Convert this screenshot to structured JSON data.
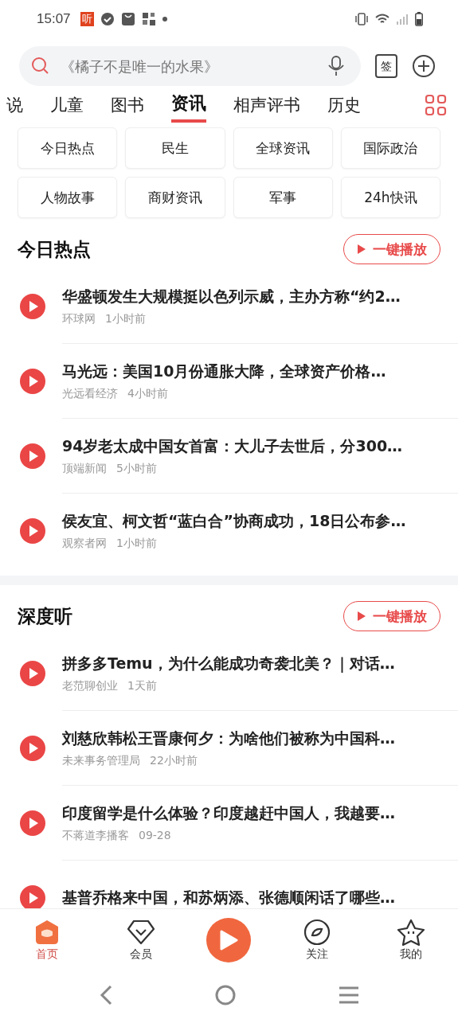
{
  "status_bar": {
    "time": "15:07",
    "app_badge": "听"
  },
  "search": {
    "placeholder": "《橘子不是唯一的水果》",
    "sign_label": "签"
  },
  "tabs": [
    {
      "label": "说",
      "selected": false
    },
    {
      "label": "儿童",
      "selected": false
    },
    {
      "label": "图书",
      "selected": false
    },
    {
      "label": "资讯",
      "selected": true
    },
    {
      "label": "相声评书",
      "selected": false
    },
    {
      "label": "历史",
      "selected": false
    }
  ],
  "categories": [
    "今日热点",
    "民生",
    "全球资讯",
    "国际政治",
    "人物故事",
    "商财资讯",
    "军事",
    "24h快讯"
  ],
  "sections": [
    {
      "title": "今日热点",
      "play_all": "一键播放",
      "items": [
        {
          "title": "华盛顿发生大规模挺以色列示威，主办方称“约2…",
          "source": "环球网",
          "time": "1小时前"
        },
        {
          "title": "马光远：美国10月份通胀大降，全球资产价格…",
          "source": "光远看经济",
          "time": "4小时前"
        },
        {
          "title": "94岁老太成中国女首富：大儿子去世后，分300…",
          "source": "顶端新闻",
          "time": "5小时前"
        },
        {
          "title": "侯友宜、柯文哲“蓝白合”协商成功，18日公布参…",
          "source": "观察者网",
          "time": "1小时前"
        }
      ]
    },
    {
      "title": "深度听",
      "play_all": "一键播放",
      "items": [
        {
          "title": "拼多多Temu，为什么能成功奇袭北美？｜对话…",
          "source": "老范聊创业",
          "time": "1天前"
        },
        {
          "title": "刘慈欣韩松王晋康何夕：为啥他们被称为中国科…",
          "source": "未来事务管理局",
          "time": "22小时前"
        },
        {
          "title": "印度留学是什么体验？印度越赶中国人，我越要…",
          "source": "不蒋道李播客",
          "time": "09-28"
        },
        {
          "title": "基普乔格来中国，和苏炳添、张德顺闲话了哪些…"
        }
      ]
    }
  ],
  "bottom_nav": [
    {
      "kind": "home",
      "label": "首页",
      "selected": true
    },
    {
      "kind": "vip",
      "label": "会员",
      "selected": false
    },
    {
      "kind": "play",
      "selected": false
    },
    {
      "kind": "follow",
      "label": "关注",
      "selected": false
    },
    {
      "kind": "me",
      "label": "我的",
      "selected": false
    }
  ]
}
